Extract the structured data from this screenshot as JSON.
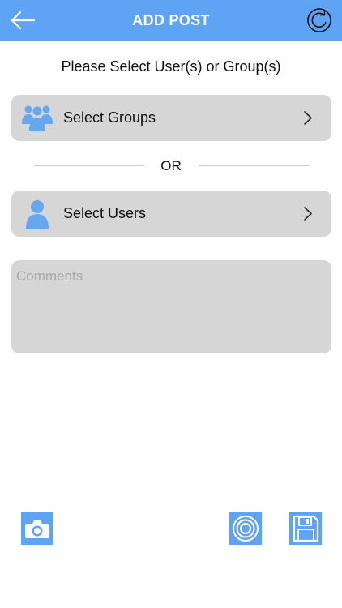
{
  "header": {
    "title": "ADD POST",
    "back_icon": "arrow-left-icon",
    "refresh_icon": "refresh-icon"
  },
  "prompt": "Please Select User(s) or Group(s)",
  "select_groups": {
    "label": "Select Groups",
    "icon": "groups-icon"
  },
  "divider_text": "OR",
  "select_users": {
    "label": "Select Users",
    "icon": "user-icon"
  },
  "comments": {
    "placeholder": "Comments",
    "value": ""
  },
  "toolbar": {
    "camera_icon": "camera-icon",
    "target_icon": "target-icon",
    "save_icon": "floppy-disk-icon"
  },
  "colors": {
    "accent": "#5ea3f4",
    "row_background": "#d6d6d6",
    "icon_blue": "#67a7ee"
  }
}
